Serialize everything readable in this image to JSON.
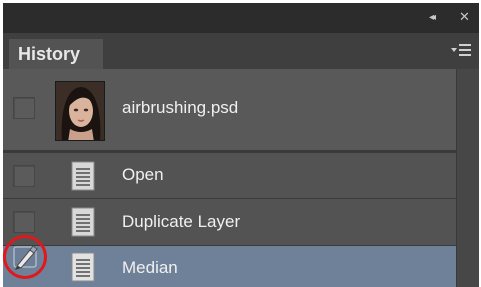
{
  "window": {
    "collapse_symbol": "◂◂",
    "close_symbol": "✕"
  },
  "panel": {
    "tab_label": "History",
    "menu_icon": "panel-menu-icon"
  },
  "snapshot": {
    "label": "airbrushing.psd",
    "thumbnail": "portrait-thumbnail"
  },
  "history_states": [
    {
      "label": "Open",
      "icon": "document-icon",
      "selected": false
    },
    {
      "label": "Duplicate Layer",
      "icon": "document-icon",
      "selected": false
    },
    {
      "label": "Median",
      "icon": "document-icon",
      "selected": true
    }
  ],
  "history_brush": {
    "icon": "history-brush-icon",
    "highlight_color": "#e0181b"
  },
  "colors": {
    "panel_bg": "#535353",
    "selected_row": "#6f8199",
    "titlebar": "#2c2c2c",
    "text": "#f0f0f0"
  }
}
